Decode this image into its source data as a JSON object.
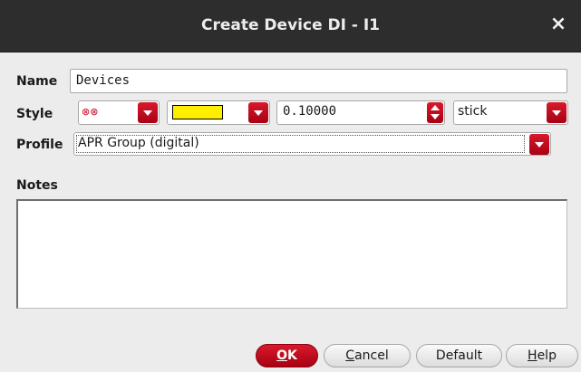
{
  "window": {
    "title": "Create Device DI - I1",
    "close_glyph": "×"
  },
  "form": {
    "name_label": "Name",
    "name_value": "Devices",
    "style_label": "Style",
    "style_pattern_glyph": "⊗⊗",
    "style_color": "#ffee00",
    "style_width_value": "0.10000",
    "style_line": "stick",
    "profile_label": "Profile",
    "profile_value": "APR Group (digital)",
    "notes_label": "Notes",
    "notes_value": ""
  },
  "buttons": {
    "ok_first": "O",
    "ok_rest": "K",
    "cancel_first": "C",
    "cancel_rest": "ancel",
    "default_label": "Default",
    "help_first": "H",
    "help_rest": "elp"
  }
}
